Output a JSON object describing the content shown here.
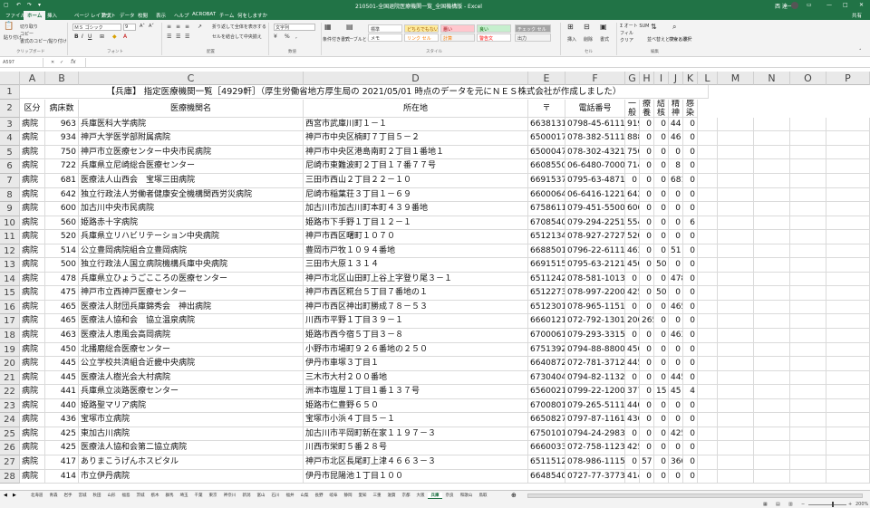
{
  "window": {
    "title": "210501-全国退院医療機関一覧_全国機構版 - Excel",
    "user": "西 達一"
  },
  "tabs": [
    "ファイル",
    "ホーム",
    "挿入",
    "ページ レイアウト",
    "数式",
    "データ",
    "校閲",
    "表示",
    "ヘルプ",
    "ACROBAT",
    "チーム",
    "何をしますか",
    "共有"
  ],
  "ribbon": {
    "paste": "貼り付け",
    "cut": "切り取り",
    "copy": "コピー",
    "format_painter": "書式のコピー/貼り付け",
    "font_name": "ＭＳ ゴシック",
    "font_size": "9",
    "wrap_text": "折り返して全体を表示する",
    "merge_center": "セルを結合して中央揃え",
    "number_format": "文字列",
    "conditional_format": "条件付き書式",
    "format_as_table": "テーブルとして書式設定",
    "styles": [
      "標準",
      "どちらでもない",
      "悪い",
      "良い",
      "チェック セル",
      "メモ",
      "リンク セル",
      "計算",
      "警告文",
      "出力"
    ],
    "insert": "挿入",
    "delete": "削除",
    "format": "書式",
    "autosum": "Σ オート SUM",
    "fill": "フィル",
    "clear": "クリア",
    "sort_filter": "並べ替えとフィルター",
    "find_select": "検索と選択",
    "groups": {
      "clipboard": "クリップボード",
      "font": "フォント",
      "alignment": "配置",
      "number": "数値",
      "styles": "スタイル",
      "cells": "セル",
      "editing": "編集"
    }
  },
  "formula_bar": {
    "name_box": "A597",
    "fx": "fx",
    "formula": ""
  },
  "columns": [
    "A",
    "B",
    "C",
    "D",
    "E",
    "F",
    "G",
    "H",
    "I",
    "J",
    "K",
    "L",
    "M",
    "N",
    "O",
    "P"
  ],
  "row_numbers": [
    1,
    2,
    3,
    4,
    5,
    6,
    7,
    8,
    9,
    10,
    11,
    12,
    13,
    14,
    15,
    16,
    17,
    18,
    19,
    20,
    21,
    22,
    23,
    24,
    25,
    26,
    27,
    28
  ],
  "sheet": {
    "title": "【兵庫】 指定医療機関一覧［4929軒］（厚生労働省地方厚生局の 2021/05/01 時点のデータを元にＮＥＳ株式会社が作成しました）",
    "headers": [
      "区分",
      "病床数",
      "医療機関名",
      "所在地",
      "〒",
      "電話番号",
      "一般",
      "療養",
      "結核",
      "精神",
      "感染"
    ]
  },
  "rows": [
    [
      "病院",
      "963",
      "兵庫医科大学病院",
      "西宮市武庫川町１－１",
      "6638131",
      "0798-45-6111",
      "919",
      "0",
      "0",
      "44",
      "0"
    ],
    [
      "病院",
      "934",
      "神戸大学医学部附属病院",
      "神戸市中央区楠町７丁目５－２",
      "6500017",
      "078-382-5111",
      "888",
      "0",
      "0",
      "46",
      "0"
    ],
    [
      "病院",
      "750",
      "神戸市立医療センター中央市民病院",
      "神戸市中央区港島南町２丁目１番地１",
      "6500047",
      "078-302-4321",
      "750",
      "0",
      "0",
      "0",
      "0"
    ],
    [
      "病院",
      "722",
      "兵庫県立尼崎総合医療センター",
      "尼崎市東難波町２丁目１７番７７号",
      "6608550",
      "06-6480-7000",
      "714",
      "0",
      "0",
      "8",
      "0"
    ],
    [
      "病院",
      "681",
      "医療法人山西会　宝塚三田病院",
      "三田市西山２丁目２２－１０",
      "6691537",
      "0795-63-4871",
      "0",
      "0",
      "0",
      "681",
      "0"
    ],
    [
      "病院",
      "642",
      "独立行政法人労働者健康安全機構関西労災病院",
      "尼崎市稲葉荘３丁目１－６９",
      "6600064",
      "06-6416-1221",
      "642",
      "0",
      "0",
      "0",
      "0"
    ],
    [
      "病院",
      "600",
      "加古川中央市民病院",
      "加古川市加古川町本町４３９番地",
      "6758611",
      "079-451-5500",
      "600",
      "0",
      "0",
      "0",
      "0"
    ],
    [
      "病院",
      "560",
      "姫路赤十字病院",
      "姫路市下手野１丁目１２－１",
      "6708540",
      "079-294-2251",
      "554",
      "0",
      "0",
      "0",
      "6"
    ],
    [
      "病院",
      "520",
      "兵庫県立リハビリテーション中央病院",
      "神戸市西区曙町１０７０",
      "6512134",
      "078-927-2727",
      "520",
      "0",
      "0",
      "0",
      "0"
    ],
    [
      "病院",
      "514",
      "公立豊岡病院組合立豊岡病院",
      "豊岡市戸牧１０９４番地",
      "6688501",
      "0796-22-6111",
      "463",
      "0",
      "0",
      "51",
      "0"
    ],
    [
      "病院",
      "500",
      "独立行政法人国立病院機構兵庫中央病院",
      "三田市大原１３１４",
      "6691515",
      "0795-63-2121",
      "450",
      "0",
      "50",
      "0",
      "0"
    ],
    [
      "病院",
      "478",
      "兵庫県立ひょうごこころの医療センター",
      "神戸市北区山田町上谷上字登り尾３－１",
      "6511242",
      "078-581-1013",
      "0",
      "0",
      "0",
      "478",
      "0"
    ],
    [
      "病院",
      "475",
      "神戸市立西神戸医療センター",
      "神戸市西区糀台５丁目７番地の１",
      "6512273",
      "078-997-2200",
      "425",
      "0",
      "50",
      "0",
      "0"
    ],
    [
      "病院",
      "465",
      "医療法人財団兵庫錦秀会　神出病院",
      "神戸市西区神出町勝成７８－５３",
      "6512301",
      "078-965-1151",
      "0",
      "0",
      "0",
      "465",
      "0"
    ],
    [
      "病院",
      "465",
      "医療法人協和会　協立温泉病院",
      "川西市平野１丁目３９－１",
      "6660121",
      "072-792-1301",
      "200",
      "265",
      "0",
      "0",
      "0"
    ],
    [
      "病院",
      "463",
      "医療法人恵風会高岡病院",
      "姫路市西今宿５丁目３－８",
      "6700061",
      "079-293-3315",
      "0",
      "0",
      "0",
      "463",
      "0"
    ],
    [
      "病院",
      "450",
      "北播磨総合医療センター",
      "小野市市場町９２６番地の２５０",
      "6751392",
      "0794-88-8800",
      "450",
      "0",
      "0",
      "0",
      "0"
    ],
    [
      "病院",
      "445",
      "公立学校共済組合近畿中央病院",
      "伊丹市車塚３丁目１",
      "6640872",
      "072-781-3712",
      "445",
      "0",
      "0",
      "0",
      "0"
    ],
    [
      "病院",
      "445",
      "医療法人樹光会大村病院",
      "三木市大村２００番地",
      "6730404",
      "0794-82-1132",
      "0",
      "0",
      "0",
      "445",
      "0"
    ],
    [
      "病院",
      "441",
      "兵庫県立淡路医療センター",
      "洲本市塩屋１丁目１番１３７号",
      "6560021",
      "0799-22-1200",
      "377",
      "0",
      "15",
      "45",
      "4"
    ],
    [
      "病院",
      "440",
      "姫路聖マリア病院",
      "姫路市仁豊野６５０",
      "6700801",
      "079-265-5111",
      "440",
      "0",
      "0",
      "0",
      "0"
    ],
    [
      "病院",
      "436",
      "宝塚市立病院",
      "宝塚市小浜４丁目５－１",
      "6650827",
      "0797-87-1161",
      "436",
      "0",
      "0",
      "0",
      "0"
    ],
    [
      "病院",
      "425",
      "東加古川病院",
      "加古川市平岡町新在家１１９７－３",
      "6750101",
      "0794-24-2983",
      "0",
      "0",
      "0",
      "425",
      "0"
    ],
    [
      "病院",
      "425",
      "医療法人協和会第二協立病院",
      "川西市栄町５番２８号",
      "6660033",
      "072-758-1123",
      "425",
      "0",
      "0",
      "0",
      "0"
    ],
    [
      "病院",
      "417",
      "ありまこうげんホスピタル",
      "神戸市北区長尾町上津４６６３－３",
      "6511512",
      "078-986-1115",
      "0",
      "57",
      "0",
      "360",
      "0"
    ],
    [
      "病院",
      "414",
      "市立伊丹病院",
      "伊丹市昆陽池１丁目１００",
      "6648540",
      "0727-77-3773",
      "414",
      "0",
      "0",
      "0",
      "0"
    ]
  ],
  "sheet_tabs": [
    "北海道",
    "青森",
    "岩手",
    "宮城",
    "秋田",
    "山形",
    "福島",
    "茨城",
    "栃木",
    "群馬",
    "埼玉",
    "千葉",
    "東京",
    "神奈川",
    "新潟",
    "富山",
    "石川",
    "福井",
    "山梨",
    "長野",
    "岐阜",
    "静岡",
    "愛知",
    "三重",
    "滋賀",
    "京都",
    "大阪",
    "兵庫",
    "奈良",
    "和歌山",
    "鳥取"
  ],
  "active_sheet": "兵庫",
  "status": {
    "zoom": "200%"
  }
}
